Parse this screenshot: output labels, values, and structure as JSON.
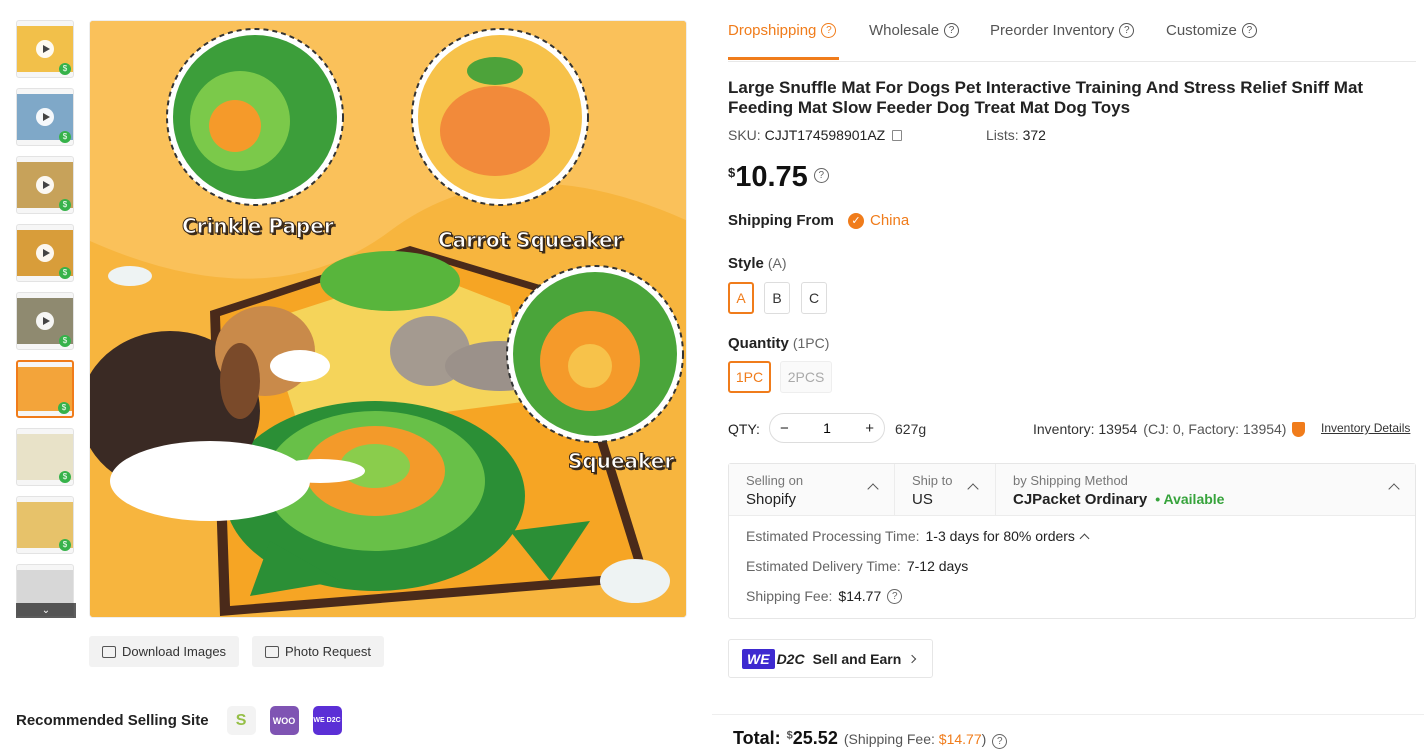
{
  "thumbnails": [
    {
      "kind": "video",
      "color": "#f2c04a"
    },
    {
      "kind": "video",
      "color": "#7fa8c8"
    },
    {
      "kind": "video",
      "color": "#c7a25a"
    },
    {
      "kind": "video",
      "color": "#d89d3a"
    },
    {
      "kind": "video",
      "color": "#8f8a70"
    },
    {
      "kind": "image",
      "color": "#f3a43a"
    },
    {
      "kind": "image",
      "color": "#e8e2c8"
    },
    {
      "kind": "image",
      "color": "#e7c26a"
    },
    {
      "kind": "image",
      "color": "#d7d7d7"
    }
  ],
  "main_image": {
    "callouts": [
      "Crinkle Paper",
      "Carrot Squeaker",
      "Squeaker"
    ]
  },
  "image_actions": {
    "download": "Download Images",
    "photo_request": "Photo Request"
  },
  "recommended": {
    "label": "Recommended Selling Site",
    "sites": [
      {
        "name": "shopify-icon",
        "text": "S",
        "color": "#95bf47"
      },
      {
        "name": "woo-icon",
        "text": "WOO",
        "color": "#7f54b3"
      },
      {
        "name": "we-d2c-icon",
        "text": "WE D2C",
        "color": "#5b2fd6"
      }
    ]
  },
  "tabs": [
    {
      "label": "Dropshipping",
      "active": true
    },
    {
      "label": "Wholesale",
      "active": false
    },
    {
      "label": "Preorder Inventory",
      "active": false
    },
    {
      "label": "Customize",
      "active": false
    }
  ],
  "product": {
    "title": "Large Snuffle Mat For Dogs Pet Interactive Training And Stress Relief Sniff Mat Feeding Mat Slow Feeder Dog Treat Mat Dog Toys",
    "sku_label": "SKU:",
    "sku": "CJJT174598901AZ",
    "lists_label": "Lists:",
    "lists": "372",
    "currency": "$",
    "price": "10.75"
  },
  "shipping_from": {
    "label": "Shipping From",
    "value": "China"
  },
  "style": {
    "label": "Style",
    "selected": "(A)",
    "options": [
      "A",
      "B",
      "C"
    ]
  },
  "quantity": {
    "label": "Quantity",
    "selected": "(1PC)",
    "options": [
      "1PC",
      "2PCS"
    ]
  },
  "qty": {
    "label": "QTY:",
    "minus": "−",
    "plus": "+",
    "value": "1",
    "weight": "627g",
    "inventory": "Inventory: 13954",
    "inventory_detail": "(CJ: 0, Factory: 13954)",
    "inventory_link": "Inventory Details"
  },
  "shipping": {
    "selling_on_label": "Selling on",
    "selling_on": "Shopify",
    "ship_to_label": "Ship to",
    "ship_to": "US",
    "method_label": "by Shipping Method",
    "method": "CJPacket Ordinary",
    "availability": "• Available",
    "processing_label": "Estimated Processing Time:",
    "processing": "1-3 days for 80% orders",
    "delivery_label": "Estimated Delivery Time:",
    "delivery": "7-12 days",
    "fee_label": "Shipping Fee:",
    "fee": "$14.77"
  },
  "d2c": {
    "logo_a": "WE",
    "logo_b": "D2C",
    "text": "Sell and Earn"
  },
  "total": {
    "label": "Total:",
    "currency": "$",
    "amount": "25.52",
    "fee_prefix": "(Shipping Fee:",
    "fee": "$14.77",
    "fee_suffix": ")"
  },
  "colors": {
    "accent": "#f07c1b",
    "available": "#36a33b"
  }
}
